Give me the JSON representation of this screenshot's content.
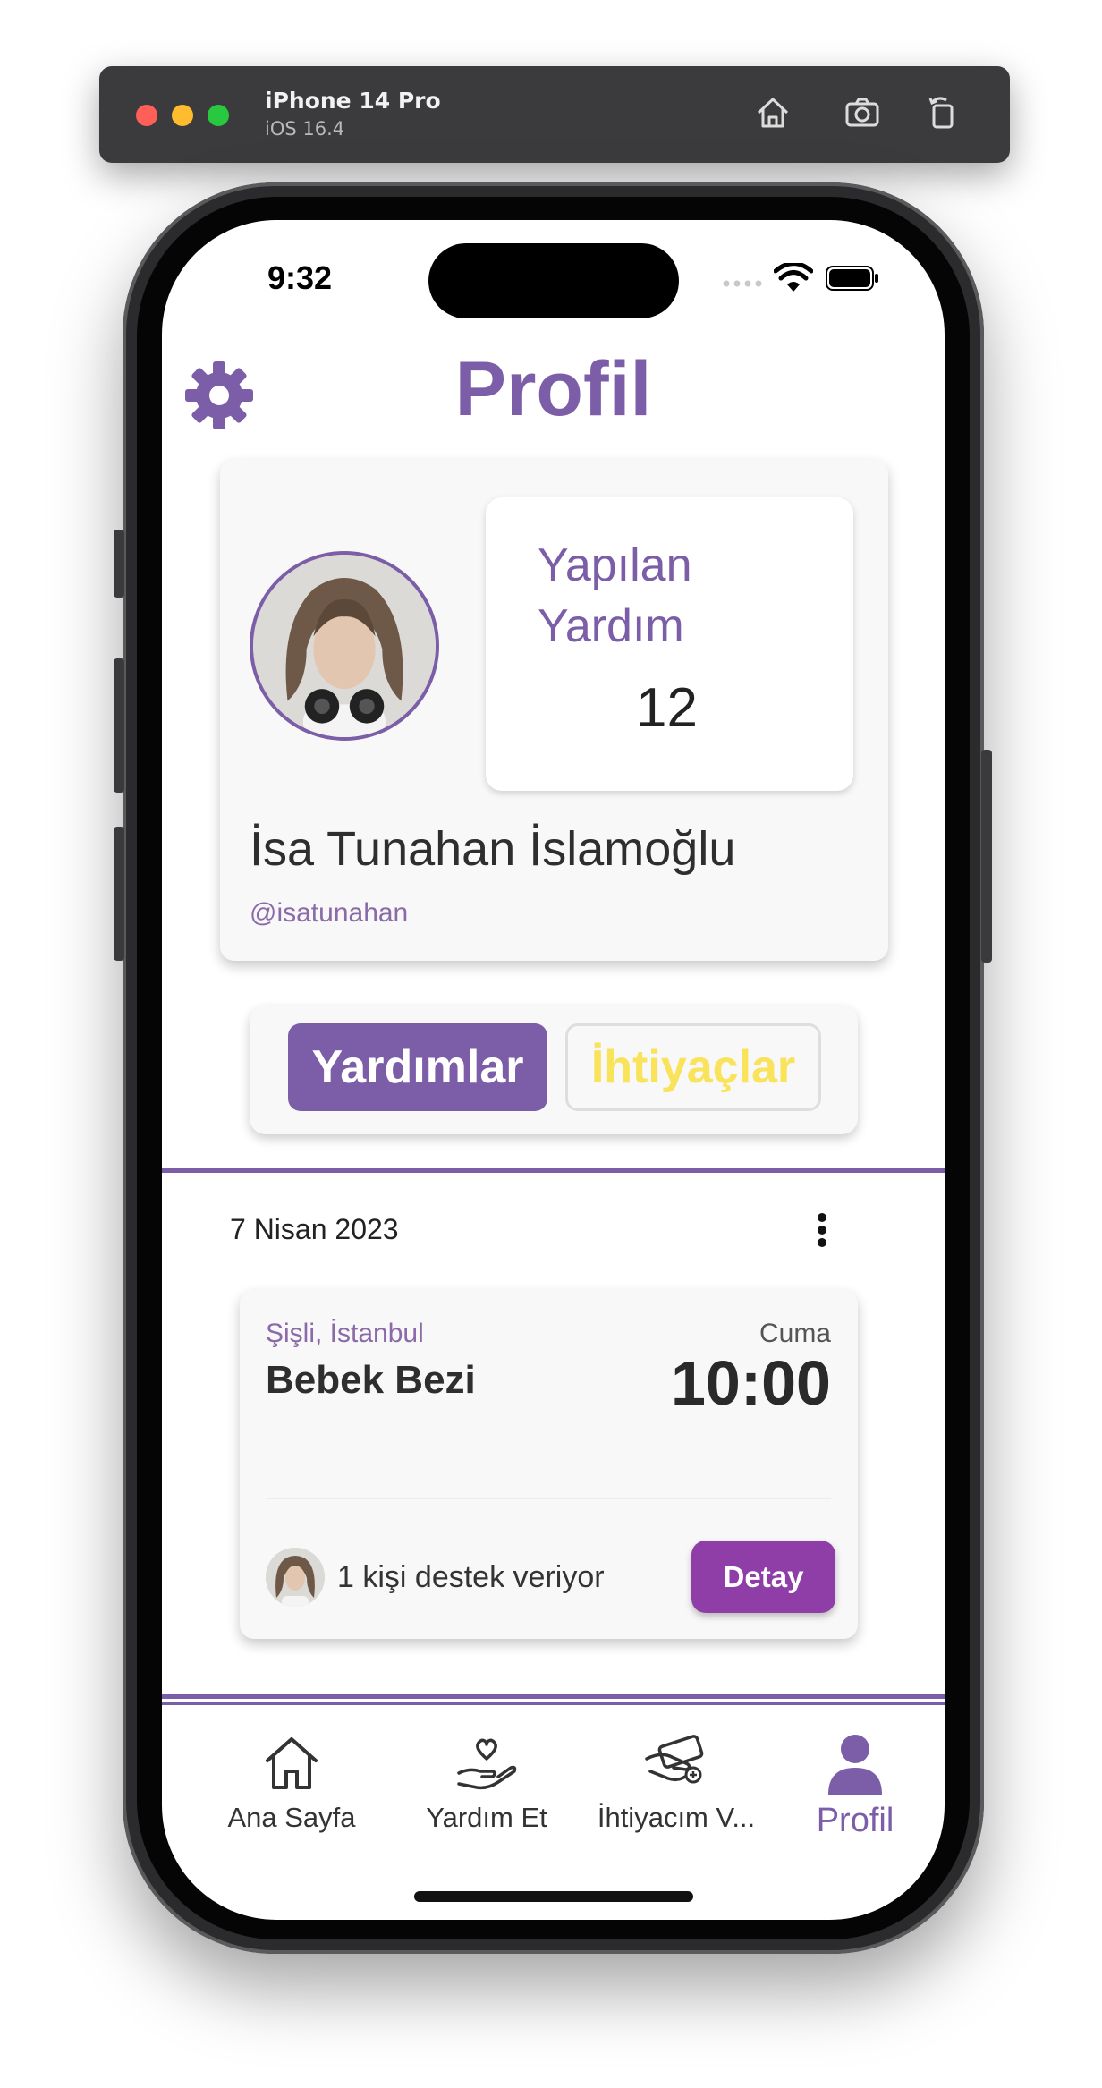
{
  "simulator": {
    "device": "iPhone 14 Pro",
    "os": "iOS 16.4",
    "icons": [
      "home-icon",
      "screenshot-icon",
      "rotate-icon"
    ]
  },
  "status_bar": {
    "time": "9:32"
  },
  "header": {
    "title": "Profil",
    "settings_icon": "gear-icon"
  },
  "profile": {
    "stat_label": "Yapılan Yardım",
    "stat_value": "12",
    "name": "İsa Tunahan İslamoğlu",
    "handle": "@isatunahan"
  },
  "segments": {
    "active": "Yardımlar",
    "inactive": "İhtiyaçlar"
  },
  "feed": {
    "date": "7 Nisan 2023",
    "event": {
      "location": "Şişli, İstanbul",
      "day": "Cuma",
      "title": "Bebek Bezi",
      "time": "10:00",
      "support_text": "1 kişi destek veriyor",
      "button_label": "Detay"
    }
  },
  "tab_bar": {
    "items": [
      {
        "label": "Ana Sayfa",
        "icon": "home-icon"
      },
      {
        "label": "Yardım Et",
        "icon": "heart-hand-icon"
      },
      {
        "label": "İhtiyacım V...",
        "icon": "hand-money-icon"
      },
      {
        "label": "Profil",
        "icon": "person-icon",
        "active": true
      }
    ]
  },
  "colors": {
    "primary": "#7b5ea7",
    "accent_yellow": "#f8e35a",
    "detail_button": "#8e3ea6"
  }
}
